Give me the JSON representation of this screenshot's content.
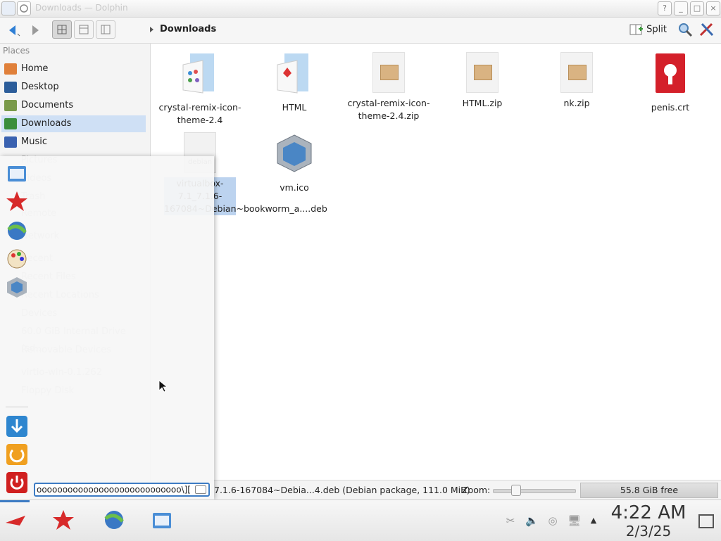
{
  "window": {
    "title": "Downloads — Dolphin",
    "help": "?",
    "minimize": "_",
    "maximize": "□",
    "close": "×"
  },
  "toolbar": {
    "breadcrumb": "Downloads",
    "split_label": "Split"
  },
  "sidebar": {
    "header": "Places",
    "items": [
      {
        "label": "Home",
        "icon": "home-icon",
        "color": "#e0803a"
      },
      {
        "label": "Desktop",
        "icon": "desktop-icon",
        "color": "#2c5d9a"
      },
      {
        "label": "Documents",
        "icon": "documents-icon",
        "color": "#7a9a4a"
      },
      {
        "label": "Downloads",
        "icon": "downloads-icon",
        "color": "#3b8e3b"
      },
      {
        "label": "Music",
        "icon": "music-icon",
        "color": "#3a62b0"
      }
    ],
    "faded_items": [
      "Pictures",
      "Videos",
      "Trash",
      "Remote",
      "Network",
      "Recent",
      "Recent Files",
      "Recent Locations",
      "Devices",
      "60.0 GiB Internal Drive (sd...",
      "Removable Devices",
      "virtio-win-0.1.262",
      "Floppy Disk"
    ]
  },
  "files": [
    {
      "name": "crystal-remix-icon-theme-2.4",
      "type": "folder"
    },
    {
      "name": "HTML",
      "type": "folder"
    },
    {
      "name": "crystal-remix-icon-theme-2.4.zip",
      "type": "zip"
    },
    {
      "name": "HTML.zip",
      "type": "zip"
    },
    {
      "name": "nk.zip",
      "type": "zip"
    },
    {
      "name": "penis.crt",
      "type": "cert"
    },
    {
      "name": "virtualbox-7.1_7.1.6-167084~Debian~bookworm_a....deb",
      "type": "deb",
      "icon_label": "debian"
    },
    {
      "name": "vm.ico",
      "type": "ico"
    }
  ],
  "status": {
    "text": "7.1.6-167084~Debia...4.deb (Debian package, 111.0 MiB)",
    "zoom_label": "Zoom:",
    "zoom_level": 0.25,
    "free_space": "55.8 GiB free"
  },
  "launcher": {
    "search_value": "oooooooooooooooooooooooooooo\\][",
    "icons": [
      "file-manager-icon",
      "kde-star-icon",
      "globe-icon",
      "palette-icon",
      "virtualbox-icon",
      "install-icon",
      "logout-icon",
      "power-icon"
    ]
  },
  "taskbar": {
    "time": "4:22 AM",
    "date": "2/3/25",
    "icons": [
      "app-menu-icon",
      "kde-star-icon",
      "browser-icon",
      "file-manager-icon"
    ],
    "tray": [
      "scissors-icon",
      "volume-icon",
      "network-icon",
      "display-icon",
      "tray-expand-icon"
    ]
  },
  "colors": {
    "accent": "#3d7cc4",
    "selection": "#cfe0f5"
  }
}
